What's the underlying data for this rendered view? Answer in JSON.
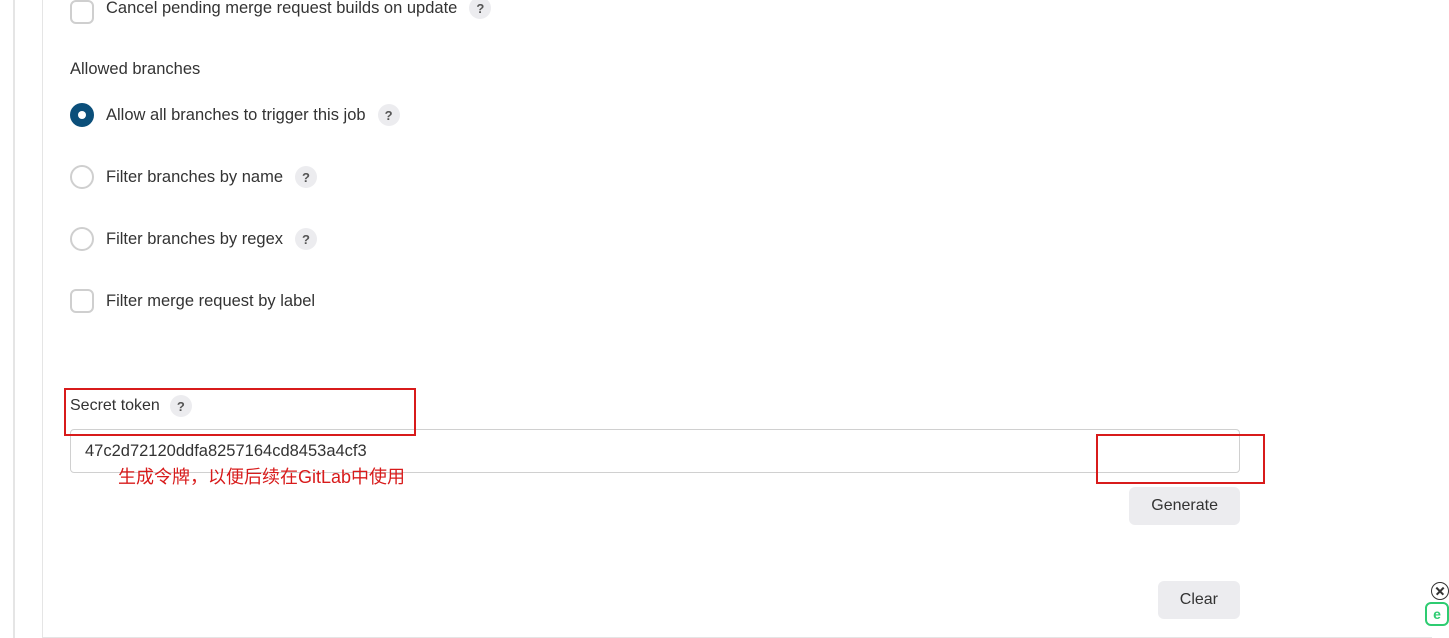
{
  "options": {
    "cancel_pending": "Cancel pending merge request builds on update",
    "allowed_branches_header": "Allowed branches",
    "allow_all": "Allow all branches to trigger this job",
    "filter_by_name": "Filter branches by name",
    "filter_by_regex": "Filter branches by regex",
    "filter_by_label": "Filter merge request by label"
  },
  "secret": {
    "label": "Secret token",
    "value": "47c2d72120ddfa8257164cd8453a4cf3"
  },
  "buttons": {
    "generate": "Generate",
    "clear": "Clear"
  },
  "annotation": "生成令牌，以便后续在GitLab中使用",
  "widget": {
    "letter": "e"
  }
}
